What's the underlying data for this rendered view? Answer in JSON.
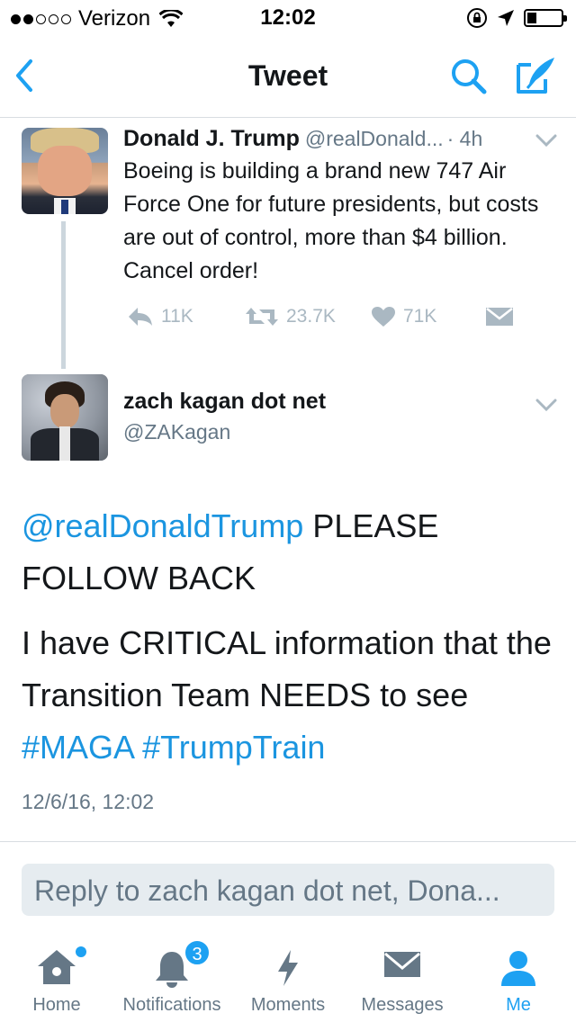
{
  "status_bar": {
    "carrier": "Verizon",
    "time": "12:02"
  },
  "nav": {
    "title": "Tweet"
  },
  "parent_tweet": {
    "name": "Donald J. Trump",
    "handle": "@realDonald...",
    "time": "· 4h",
    "text": "Boeing is building a brand new 747 Air Force One for future presidents, but costs are out of control, more than $4 billion. Cancel order!",
    "replies": "11K",
    "retweets": "23.7K",
    "likes": "71K"
  },
  "focused_tweet": {
    "name": "zach kagan dot net",
    "handle": "@ZAKagan",
    "mention": "@realDonaldTrump",
    "text1_rest": " PLEASE FOLLOW BACK",
    "text2": "I have CRITICAL information that the Transition Team NEEDS to see",
    "hashtag1": "#MAGA",
    "hashtag2": "#TrumpTrain",
    "timestamp": "12/6/16, 12:02"
  },
  "reply": {
    "placeholder": "Reply to zach kagan dot net, Dona..."
  },
  "tabs": {
    "home": "Home",
    "notifications": "Notifications",
    "notifications_badge": "3",
    "moments": "Moments",
    "messages": "Messages",
    "me": "Me"
  },
  "colors": {
    "accent": "#1da1f2",
    "link": "#1b95e0",
    "muted": "#657786",
    "action_icon": "#aab8c2"
  },
  "icons": {
    "back": "chevron-left-icon",
    "search": "search-icon",
    "compose": "compose-icon",
    "reply": "reply-icon",
    "retweet": "retweet-icon",
    "like": "heart-icon",
    "dm": "envelope-icon"
  }
}
